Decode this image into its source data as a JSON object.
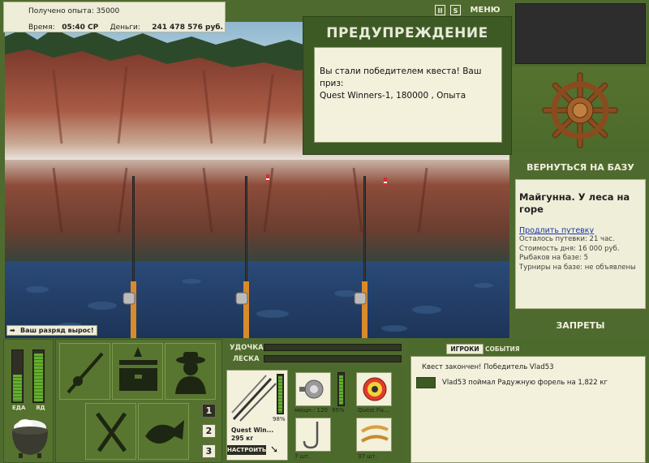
{
  "hud": {
    "exp_label": "Получено опыта:",
    "exp_value": "35000",
    "time_label": "Время:",
    "time_value": "05:40 СР",
    "money_label": "Деньги:",
    "money_value": "241 478 576 руб."
  },
  "top_controls": {
    "pause_glyph": "II",
    "sound_glyph": "S",
    "menu_label": "МЕНЮ"
  },
  "warning": {
    "title": "ПРЕДУПРЕЖДЕНИЕ",
    "line1": "Вы стали победителем квеста! Ваш приз:",
    "line2": "Quest Winners-1, 180000 , Опыта"
  },
  "rank_message": "Ваш разряд вырос!",
  "right_panel": {
    "back_label": "ВЕРНУТЬСЯ НА БАЗУ",
    "location": "Майгунна. У леса на горе",
    "extend_link": "Продлить путевку",
    "stats": [
      "Осталось путевки: 21 час.",
      "Стоимость дня: 16 000 руб.",
      "Рыбаков на базе: 5",
      "Турниры на базе: не объявлены"
    ],
    "bans_label": "ЗАПРЕТЫ"
  },
  "status_bars": {
    "food_label": "ЕДА",
    "poison_label": "ЯД",
    "food_level": 0.55,
    "poison_level": 0.95
  },
  "hotkeys": [
    "1",
    "2",
    "3"
  ],
  "tackle": {
    "rod_label": "УДОЧКА",
    "line_label": "ЛЕСКА",
    "rod_name": "Quest Win...",
    "rod_weight": "295 кг",
    "rod_percent": "98%",
    "rod_level": 0.98,
    "reel_caption": "мощн.: 120",
    "reel_percent": "95%",
    "reel_level": 0.95,
    "line_caption": "Quest Fis...",
    "hook_count": "7 шт.",
    "bait_count": "37 шт.",
    "setup_button": "НАСТРОИТЬ"
  },
  "chat": {
    "tab_players": "ИГРОКИ",
    "tab_events": "СОБЫТИЯ",
    "messages": [
      "Квест закончен! Победитель Vlad53",
      "Vlad53 поймал Радужную форель на 1,822 кг"
    ]
  },
  "colors": {
    "panel_green": "#4f6a2e",
    "card_cream": "#efeed8",
    "bar_green": "#66ae2e",
    "link_blue": "#1a34a8"
  }
}
